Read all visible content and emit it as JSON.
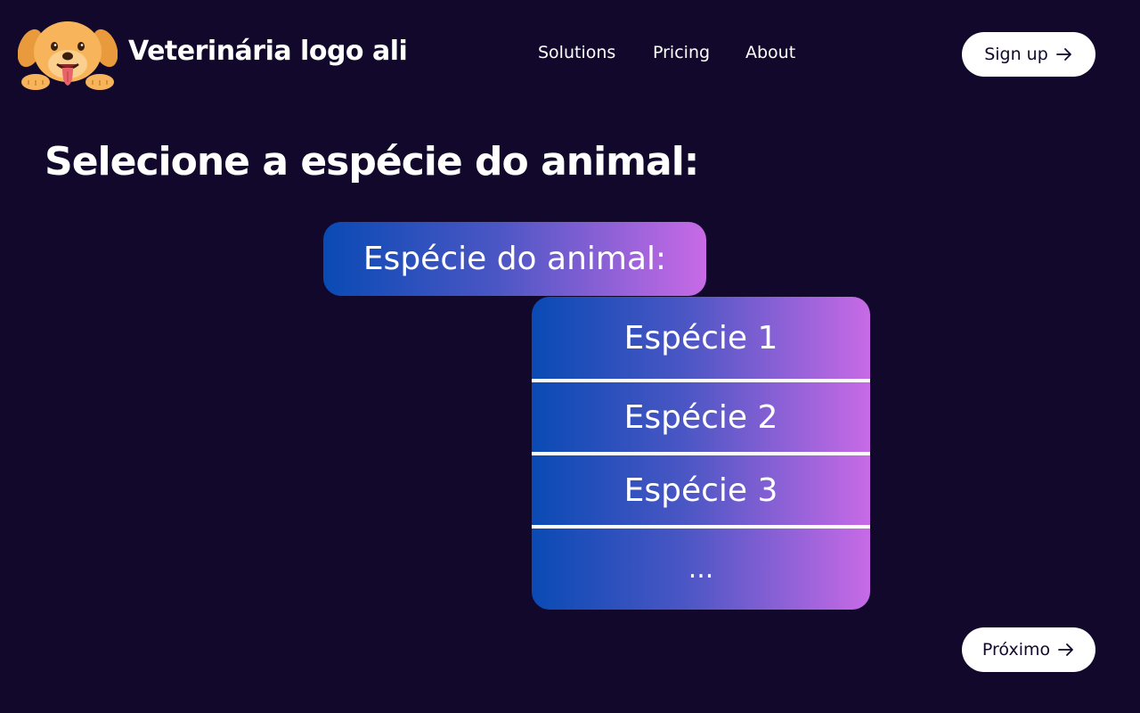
{
  "header": {
    "brand": "Veterinária logo ali",
    "nav": [
      {
        "label": "Solutions"
      },
      {
        "label": "Pricing"
      },
      {
        "label": "About"
      }
    ],
    "signup_label": "Sign up",
    "signup_icon": "arrow-right-icon",
    "logo_icon": "dog-logo-icon"
  },
  "main": {
    "headline": "Selecione a espécie do animal:",
    "species_label": "Espécie do animal:",
    "options": [
      {
        "label": "Espécie 1"
      },
      {
        "label": "Espécie 2"
      },
      {
        "label": "Espécie 3"
      },
      {
        "label": "..."
      }
    ],
    "next_label": "Próximo",
    "next_icon": "arrow-right-icon"
  },
  "colors": {
    "background": "#12082c",
    "gradient_start": "#0a4ab4",
    "gradient_end": "#c86ae6",
    "button_bg": "#ffffff",
    "button_text": "#12082c"
  }
}
